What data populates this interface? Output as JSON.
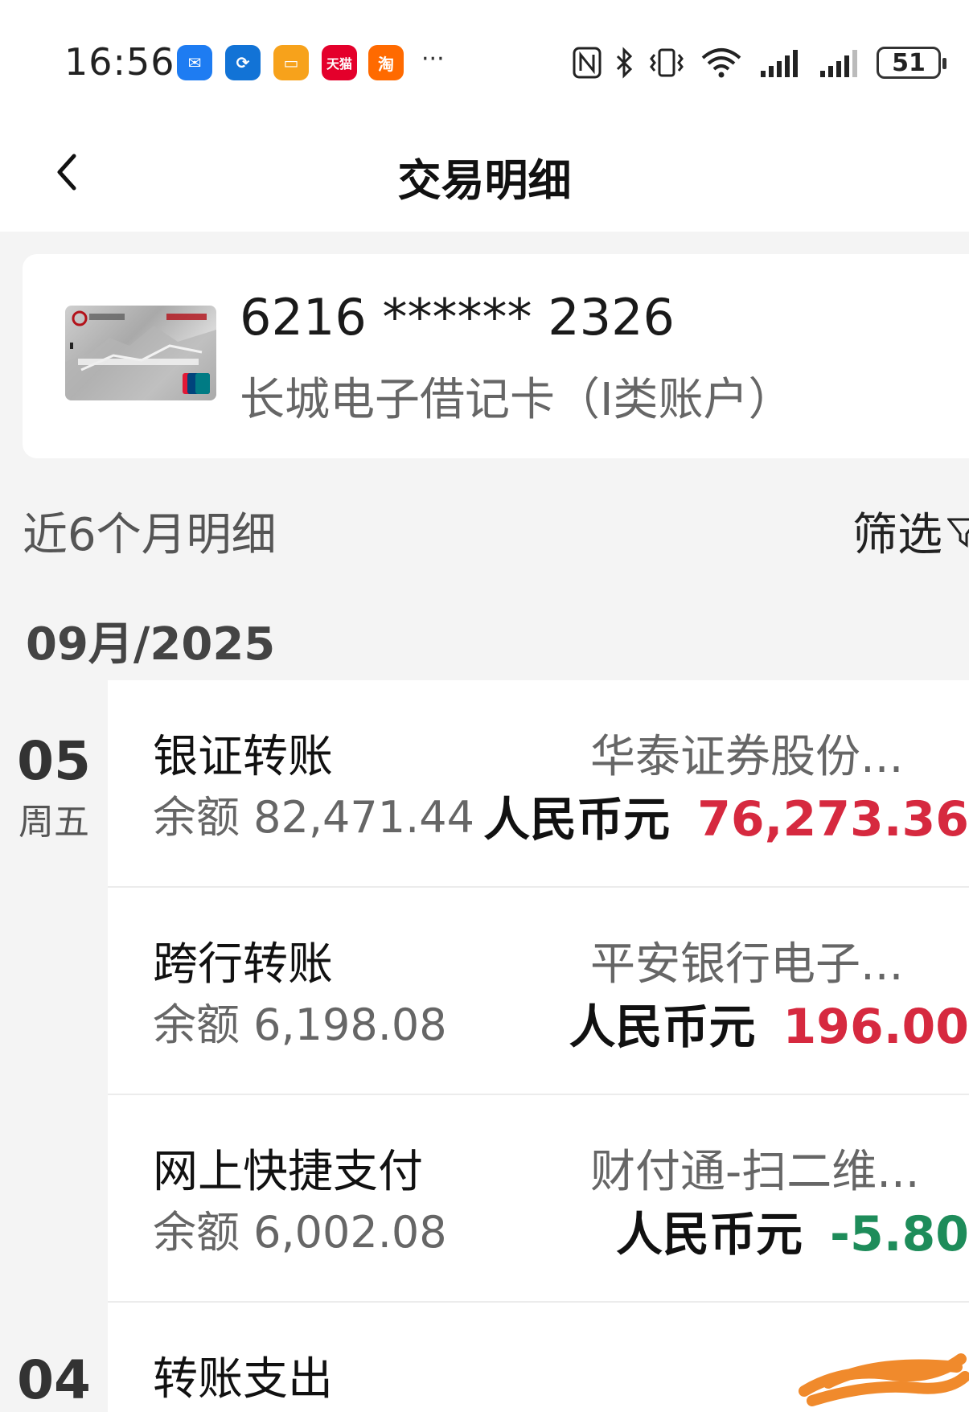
{
  "status_bar": {
    "time": "16:56",
    "apps": [
      {
        "name": "mail-app-icon",
        "color": "#1e7cf2",
        "glyph": "✉"
      },
      {
        "name": "sync-app-icon",
        "color": "#1273d6",
        "glyph": "⟳"
      },
      {
        "name": "notes-app-icon",
        "color": "#f7a21b",
        "glyph": "▭"
      },
      {
        "name": "tmall-app-icon",
        "color": "#e4002b",
        "glyph": "天猫"
      },
      {
        "name": "taobao-app-icon",
        "color": "#ff6a00",
        "glyph": "淘"
      }
    ],
    "more": "···",
    "battery": "51"
  },
  "header": {
    "title": "交易明细"
  },
  "account": {
    "card_number": "6216 ****** 2326",
    "card_type": "长城电子借记卡（I类账户）"
  },
  "section": {
    "period": "近6个月明细",
    "filter": "筛选"
  },
  "month": "09月/2025",
  "days": [
    {
      "day": "05",
      "weekday": "周五"
    },
    {
      "day": "04",
      "weekday": ""
    }
  ],
  "transactions": [
    {
      "type": "银证转账",
      "balance": "余额 82,471.44",
      "party": "华泰证券股份...",
      "currency": "人民币元",
      "amount": "76,273.36",
      "direction": "in"
    },
    {
      "type": "跨行转账",
      "balance": "余额 6,198.08",
      "party": "平安银行电子...",
      "currency": "人民币元",
      "amount": "196.00",
      "direction": "in"
    },
    {
      "type": "网上快捷支付",
      "balance": "余额 6,002.08",
      "party": "财付通-扫二维...",
      "currency": "人民币元",
      "amount": "-5.80",
      "direction": "out"
    },
    {
      "type": "转账支出",
      "balance": "",
      "party": "",
      "currency": "",
      "amount": "",
      "direction": "out"
    }
  ],
  "colors": {
    "income": "#d6293f",
    "expense": "#1e8c5a",
    "redaction": "#f08a2c"
  }
}
